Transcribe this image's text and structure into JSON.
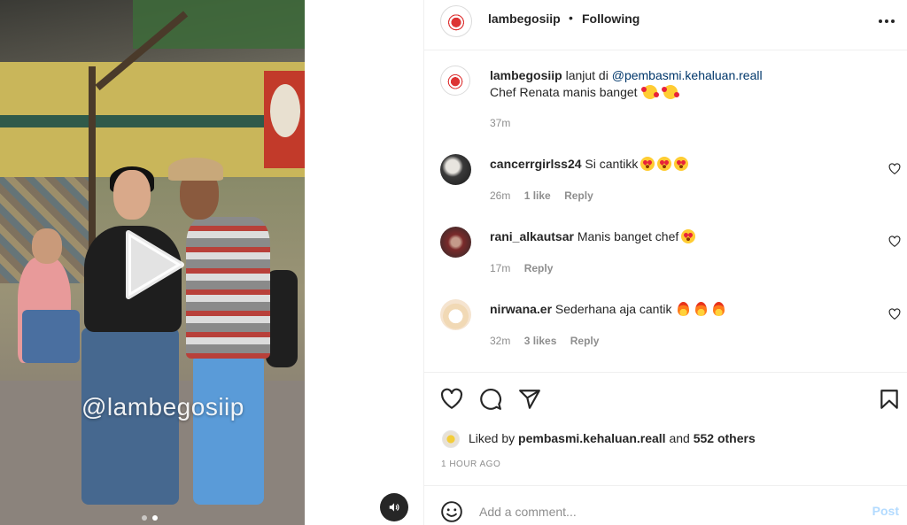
{
  "post": {
    "watermark": "@lambegosiip",
    "slide_count": 2,
    "active_slide": 2
  },
  "header": {
    "username": "lambegosiip",
    "separator": "•",
    "follow_status": "Following",
    "more_icon": "more-horizontal-icon"
  },
  "caption": {
    "username": "lambegosiip",
    "text_prefix": "lanjut di ",
    "mention": "@pembasmi.kehaluan.reall",
    "line2": "Chef Renata manis banget",
    "emoji": [
      "smiling-face-with-hearts",
      "smiling-face-with-hearts"
    ],
    "time": "37m"
  },
  "comments": [
    {
      "username": "cancerrgirlss24",
      "text": "Si cantikk",
      "emoji": [
        "heart-eyes",
        "heart-eyes",
        "heart-eyes"
      ],
      "time": "26m",
      "likes": "1 like",
      "reply": "Reply"
    },
    {
      "username": "rani_alkautsar",
      "text": "Manis banget chef",
      "emoji": [
        "heart-eyes"
      ],
      "time": "17m",
      "likes": "",
      "reply": "Reply"
    },
    {
      "username": "nirwana.er",
      "text": "Sederhana aja cantik",
      "emoji": [
        "fire",
        "fire",
        "fire"
      ],
      "time": "32m",
      "likes": "3 likes",
      "reply": "Reply"
    }
  ],
  "actions": {
    "like_icon": "heart-icon",
    "comment_icon": "comment-icon",
    "share_icon": "paper-plane-icon",
    "save_icon": "bookmark-icon"
  },
  "likes": {
    "prefix": "Liked by ",
    "user": "pembasmi.kehaluan.reall",
    "middle": " and ",
    "others": "552 others"
  },
  "posted": "1 HOUR AGO",
  "add_comment": {
    "placeholder": "Add a comment...",
    "post_label": "Post",
    "emoji_icon": "emoji-smile-icon"
  },
  "colors": {
    "text": "#262626",
    "muted": "#8e8e8e",
    "mention": "#00376b",
    "post_disabled": "#b3dbff",
    "divider": "#efefef"
  }
}
